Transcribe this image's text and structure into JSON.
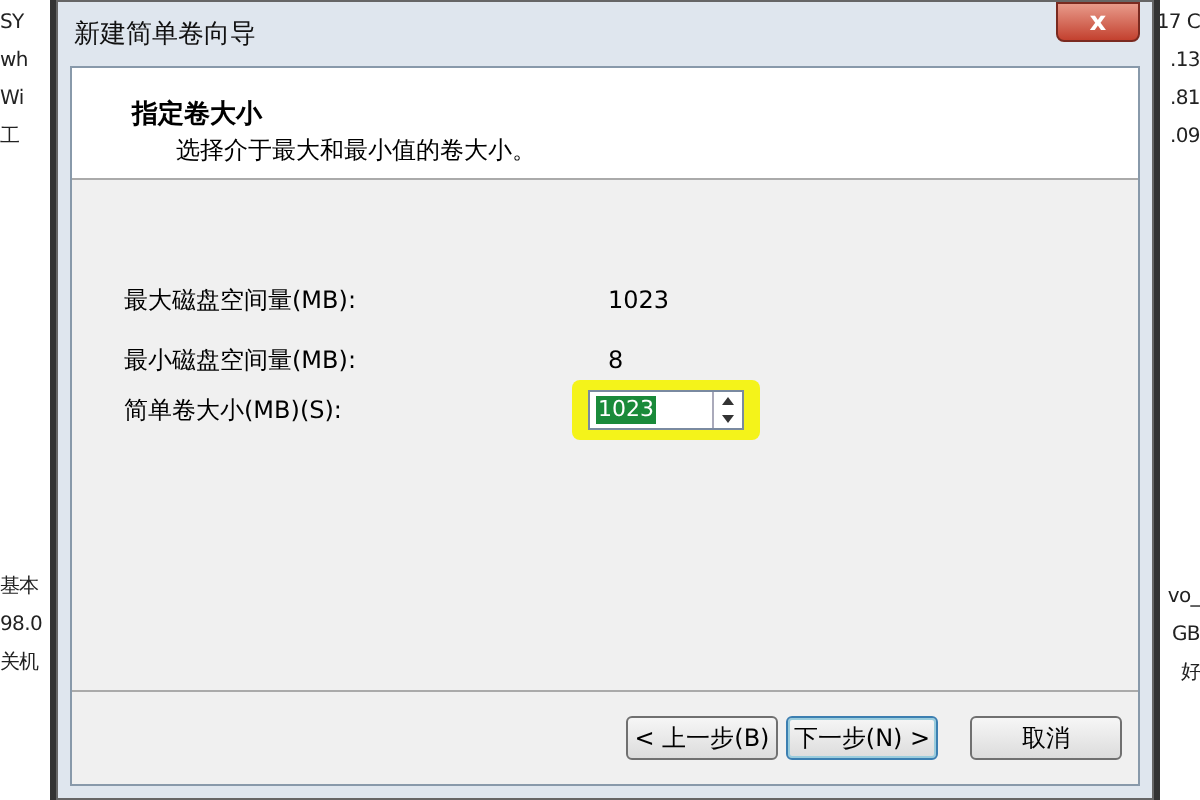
{
  "background": {
    "left_lines": [
      "SY",
      "wh",
      "Wi",
      "工",
      "基本",
      "98.0",
      "关机"
    ],
    "right_lines": [
      "17 C",
      ".13",
      ".81",
      ".09",
      "vo_",
      "GB",
      "好"
    ]
  },
  "window": {
    "title": "新建简单卷向导",
    "close": "x"
  },
  "header": {
    "title": "指定卷大小",
    "subtitle": "选择介于最大和最小值的卷大小。"
  },
  "fields": [
    {
      "kind": "readout",
      "label": "最大磁盘空间量(MB):",
      "value": "1023"
    },
    {
      "kind": "readout",
      "label": "最小磁盘空间量(MB):",
      "value": "8"
    },
    {
      "kind": "spinner",
      "label": "简单卷大小(MB)(S):",
      "value": "1023",
      "highlighted": true
    }
  ],
  "buttons": [
    {
      "label": "< 上一步(B)",
      "default": false
    },
    {
      "label": "下一步(N) >",
      "default": true
    },
    {
      "label": "取消",
      "default": false
    }
  ]
}
